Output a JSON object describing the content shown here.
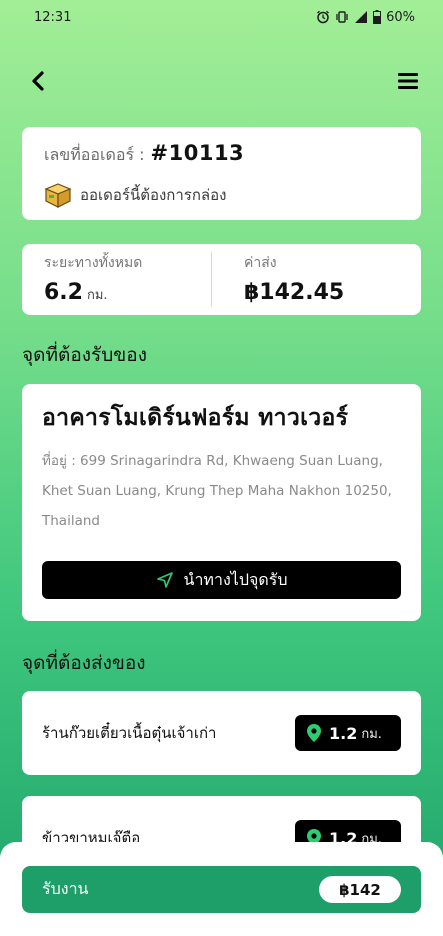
{
  "status_bar": {
    "time": "12:31",
    "battery": "60%"
  },
  "order": {
    "label": "เลขที่ออเดอร์ :",
    "number": "#10113",
    "box_note": "ออเดอร์นี้ต้องการกล่อง"
  },
  "distance": {
    "label": "ระยะทางทั้งหมด",
    "value": "6.2",
    "unit": "กม."
  },
  "fee": {
    "label": "ค่าส่ง",
    "value": "฿142.45"
  },
  "pickup": {
    "section_title": "จุดที่ต้องรับของ",
    "name": "อาคารโมเดิร์นฟอร์ม ทาวเวอร์",
    "address": "ที่อยู่ : 699 Srinagarindra Rd, Khwaeng Suan Luang, Khet Suan Luang, Krung Thep Maha Nakhon 10250, Thailand",
    "nav_button": "นำทางไปจุดรับ"
  },
  "dropoff": {
    "section_title": "จุดที่ต้องส่งของ",
    "items": [
      {
        "name": "ร้านก๊วยเตี๋ยวเนื้อตุ๋นเจ้าเก่า",
        "km": "1.2",
        "unit": "กม."
      },
      {
        "name": "ข้าวขาหมูเจ๊ตือ",
        "km": "1.2",
        "unit": "กม."
      }
    ]
  },
  "accept": {
    "label": "รับงาน",
    "amount": "฿142"
  },
  "colors": {
    "accent": "#1e9e68",
    "gradient_top": "#a2ee96",
    "badge_bg": "#000000",
    "pin": "#2ecc71"
  },
  "icons": [
    "back-arrow-icon",
    "hamburger-menu-icon",
    "box-icon",
    "navigation-arrow-icon",
    "location-pin-icon",
    "alarm-icon",
    "vibrate-icon",
    "signal-icon",
    "battery-icon"
  ]
}
